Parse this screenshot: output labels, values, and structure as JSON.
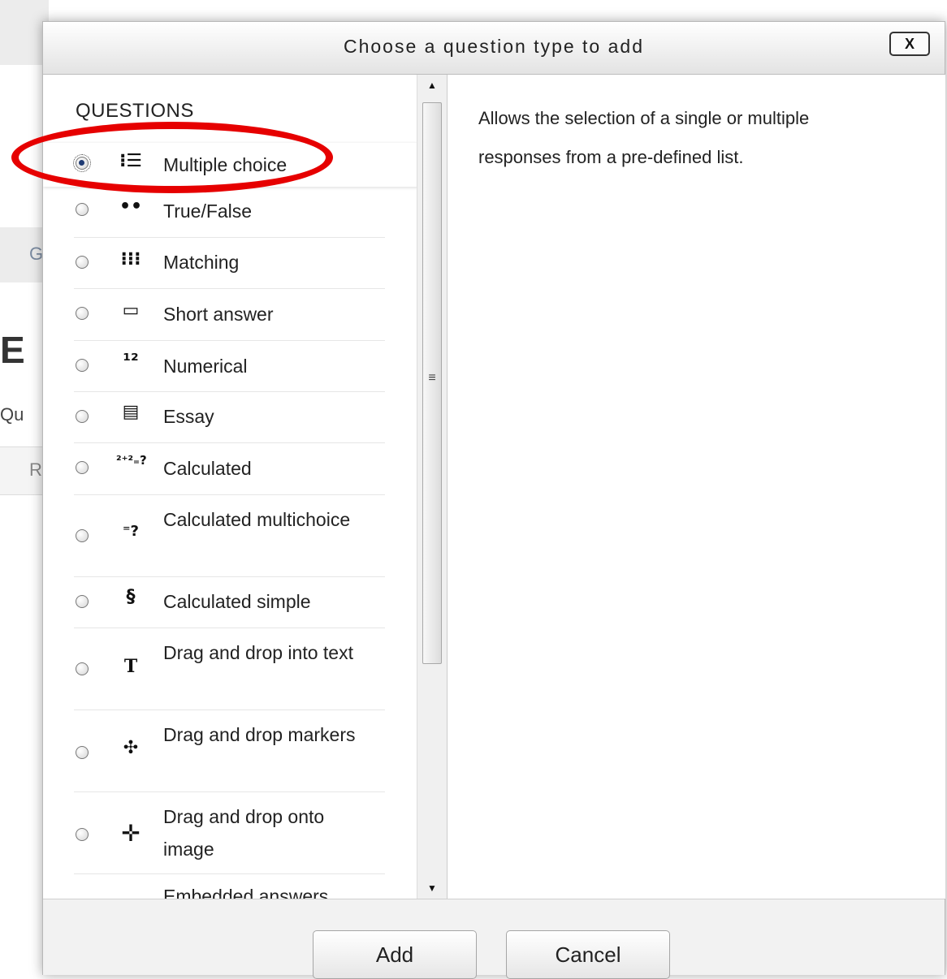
{
  "background_page": {
    "fragments": [
      "G",
      "E",
      "Qu",
      "R"
    ]
  },
  "dialog": {
    "title": "Choose a question type to add",
    "close_label": "X",
    "section_heading": "QUESTIONS",
    "selected_description": "Allows the selection of a single or multiple responses from a pre-defined list.",
    "question_types": [
      {
        "label": "Multiple choice",
        "icon": "multiple-choice-icon",
        "glyph": "⁝☰",
        "selected": true
      },
      {
        "label": "True/False",
        "icon": "true-false-icon",
        "glyph": "••",
        "selected": false
      },
      {
        "label": "Matching",
        "icon": "matching-icon",
        "glyph": "⁝⁝⁝",
        "selected": false
      },
      {
        "label": "Short answer",
        "icon": "short-answer-icon",
        "glyph": "▭",
        "selected": false
      },
      {
        "label": "Numerical",
        "icon": "numerical-icon",
        "glyph": "¹²",
        "selected": false
      },
      {
        "label": "Essay",
        "icon": "essay-icon",
        "glyph": "▤",
        "selected": false
      },
      {
        "label": "Calculated",
        "icon": "calculated-icon",
        "glyph": "²⁺²₌?",
        "selected": false
      },
      {
        "label": "Calculated multichoice",
        "icon": "calculated-multichoice-icon",
        "glyph": "⁼?",
        "selected": false
      },
      {
        "label": "Calculated simple",
        "icon": "calculated-simple-icon",
        "glyph": "§",
        "selected": false
      },
      {
        "label": "Drag and drop into text",
        "icon": "drag-drop-text-icon",
        "glyph": "T",
        "selected": false
      },
      {
        "label": "Drag and drop markers",
        "icon": "drag-drop-markers-icon",
        "glyph": "✣",
        "selected": false
      },
      {
        "label": "Drag and drop onto image",
        "icon": "drag-drop-image-icon",
        "glyph": "✛",
        "selected": false
      },
      {
        "label": "Embedded answers",
        "icon": "embedded-answers-icon",
        "glyph": "▪▬",
        "selected": false
      }
    ],
    "buttons": {
      "add": "Add",
      "cancel": "Cancel"
    },
    "highlight_color": "#e60000"
  }
}
